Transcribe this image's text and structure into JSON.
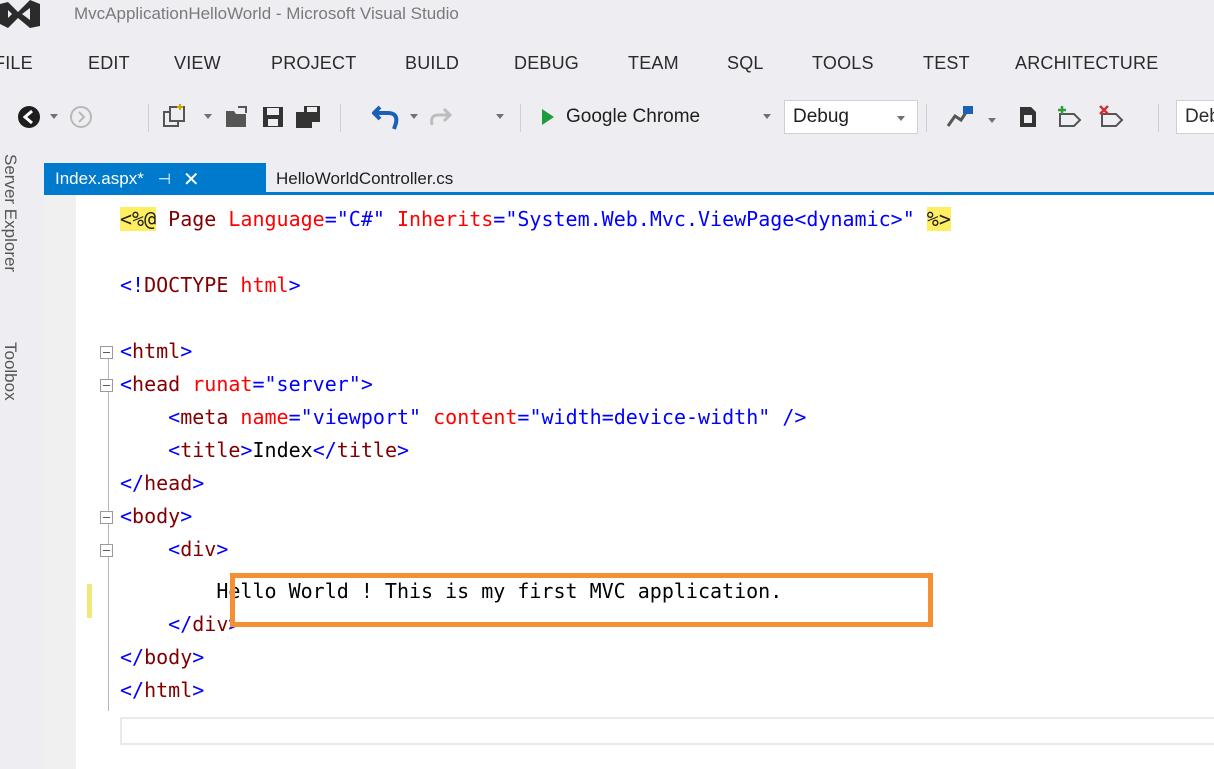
{
  "window": {
    "title": "MvcApplicationHelloWorld - Microsoft Visual Studio",
    "logo_icon": "visual-studio-icon"
  },
  "menu": [
    "FILE",
    "EDIT",
    "VIEW",
    "PROJECT",
    "BUILD",
    "DEBUG",
    "TEAM",
    "SQL",
    "TOOLS",
    "TEST",
    "ARCHITECTURE"
  ],
  "toolbar": {
    "run_target": "Google Chrome",
    "configuration": "Debug",
    "platform": "Debug",
    "run_color": "#1e9b3c"
  },
  "side_tabs": [
    "Server Explorer",
    "Toolbox"
  ],
  "tabs": [
    {
      "name": "Index.aspx*",
      "active": true,
      "pin": "⊣",
      "close": "✕"
    },
    {
      "name": "HelloWorldController.cs",
      "active": false
    }
  ],
  "code": {
    "line1": {
      "open": "<%@",
      "page": " Page ",
      "a1": "Language",
      "eq1": "=",
      "v1": "\"C#\"",
      "a2": " Inherits",
      "eq2": "=",
      "v2": "\"System.Web.Mvc.ViewPage<dynamic>\"",
      "close": "%>"
    },
    "line2": {
      "open": "<!",
      "tag": "DOCTYPE",
      "attr": " html",
      "close": ">"
    },
    "html_open": {
      "lt": "<",
      "tag": "html",
      "gt": ">"
    },
    "head_open": {
      "lt": "<",
      "tag": "head",
      "attr": " runat",
      "eq": "=",
      "val": "\"server\"",
      "gt": ">"
    },
    "meta": {
      "lt": "<",
      "tag": "meta",
      "a1": " name",
      "eq1": "=",
      "v1": "\"viewport\"",
      "a2": " content",
      "eq2": "=",
      "v2": "\"width=device-width\"",
      "end": " />"
    },
    "title": {
      "lt": "<",
      "tag": "title",
      "gt": ">",
      "text": "Index",
      "lt2": "</",
      "tag2": "title",
      "gt2": ">"
    },
    "head_close": {
      "lt": "</",
      "tag": "head",
      "gt": ">"
    },
    "body_open": {
      "lt": "<",
      "tag": "body",
      "gt": ">"
    },
    "div_open": {
      "lt": "<",
      "tag": "div",
      "gt": ">"
    },
    "hello": "Hello World ! This is my first MVC application.",
    "div_close": {
      "lt": "</",
      "tag": "div",
      "gt": ">"
    },
    "body_close": {
      "lt": "</",
      "tag": "body",
      "gt": ">"
    },
    "html_close": {
      "lt": "</",
      "tag": "html",
      "gt": ">"
    }
  },
  "colors": {
    "accent": "#007acc",
    "highlight_box": "#f39034",
    "directive_bg": "#ffee62"
  }
}
